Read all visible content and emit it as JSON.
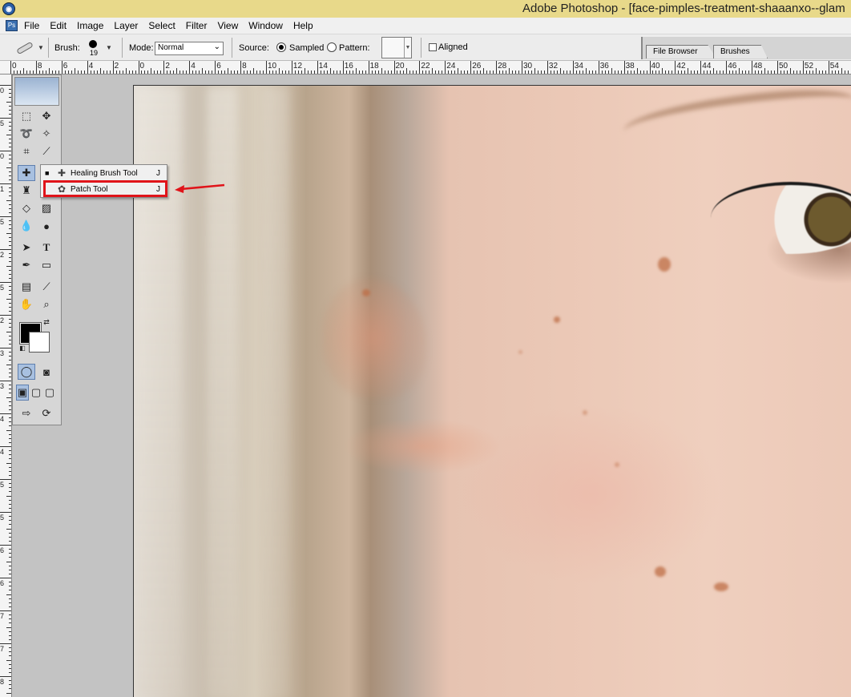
{
  "window": {
    "title": "Adobe Photoshop - [face-pimples-treatment-shaaanxo--glam",
    "app_icon": "photoshop-icon"
  },
  "menubar": {
    "items": [
      "File",
      "Edit",
      "Image",
      "Layer",
      "Select",
      "Filter",
      "View",
      "Window",
      "Help"
    ]
  },
  "options": {
    "brush_label": "Brush:",
    "brush_size": "19",
    "mode_label": "Mode:",
    "mode_value": "Normal",
    "source_label": "Source:",
    "sampled_label": "Sampled",
    "pattern_label": "Pattern:",
    "aligned_label": "Aligned",
    "source_selected": "Sampled"
  },
  "palette_well": {
    "tabs": [
      "File Browser",
      "Brushes"
    ]
  },
  "ruler": {
    "h_labels": [
      "0",
      "8",
      "6",
      "4",
      "2",
      "0",
      "2",
      "4",
      "6",
      "8",
      "10",
      "12",
      "14",
      "16",
      "18",
      "20",
      "22",
      "24",
      "26",
      "28",
      "30",
      "32",
      "34",
      "36",
      "38",
      "40",
      "42",
      "44",
      "46",
      "48",
      "50",
      "52",
      "54"
    ],
    "v_labels": [
      "0",
      "5",
      "0",
      "1",
      "5",
      "2",
      "5",
      "2",
      "3",
      "3",
      "4",
      "4",
      "5",
      "5",
      "6",
      "6",
      "7",
      "7",
      "8"
    ]
  },
  "flyout": {
    "items": [
      {
        "label": "Healing Brush Tool",
        "shortcut": "J",
        "icon": "bandage-icon",
        "active": true
      },
      {
        "label": "Patch Tool",
        "shortcut": "J",
        "icon": "patch-icon",
        "active": false
      }
    ]
  },
  "colors": {
    "highlight": "#e0141a",
    "foreground": "#000000",
    "background": "#ffffff",
    "titlebar": "#e8d98a"
  }
}
